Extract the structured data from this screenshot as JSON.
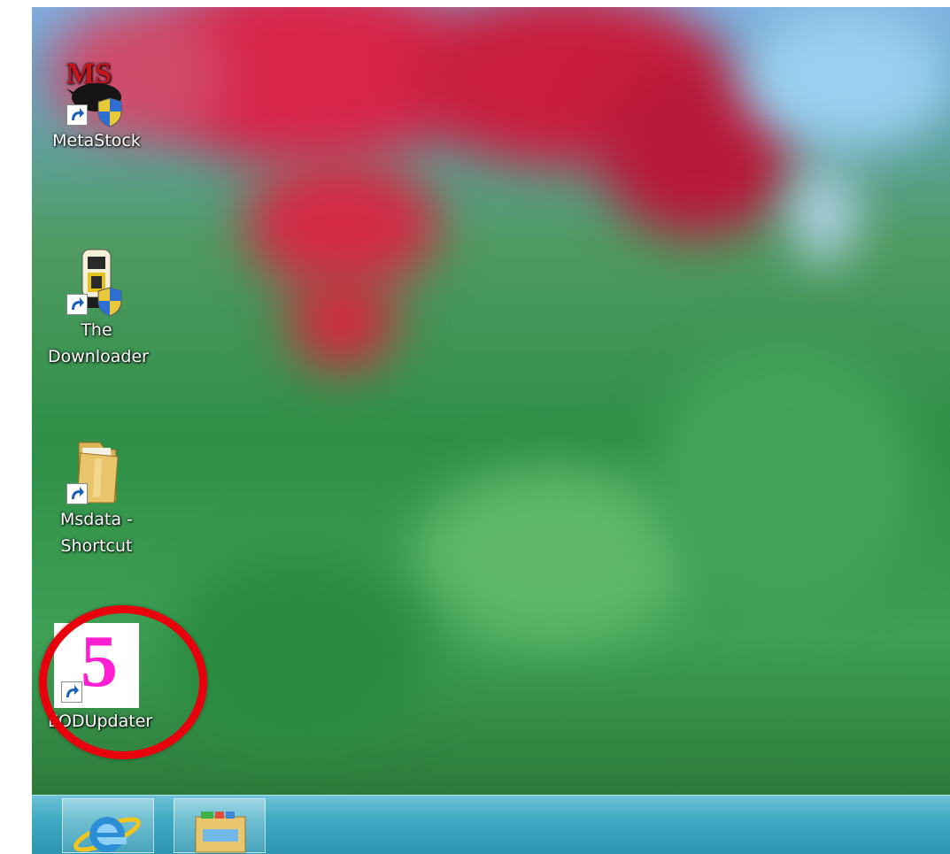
{
  "desktop": {
    "icons": [
      {
        "label": "MetaStock",
        "icon": "metastock-bull-icon"
      },
      {
        "label_lines": [
          "The",
          "Downloader"
        ],
        "icon": "downloader-icon"
      },
      {
        "label_lines": [
          "Msdata -",
          "Shortcut"
        ],
        "icon": "folder-icon"
      },
      {
        "label": "EODUpdater",
        "icon": "eodupdater-5-icon",
        "glyph": "5",
        "highlighted": true
      }
    ],
    "metastock_logo_text": "MS"
  },
  "taskbar": {
    "buttons": [
      {
        "icon": "internet-explorer-icon"
      },
      {
        "icon": "file-explorer-icon"
      }
    ]
  },
  "colors": {
    "highlight": "#e8000c",
    "eod_glyph": "#ff1ed2",
    "taskbar": "#3ea9c2"
  }
}
